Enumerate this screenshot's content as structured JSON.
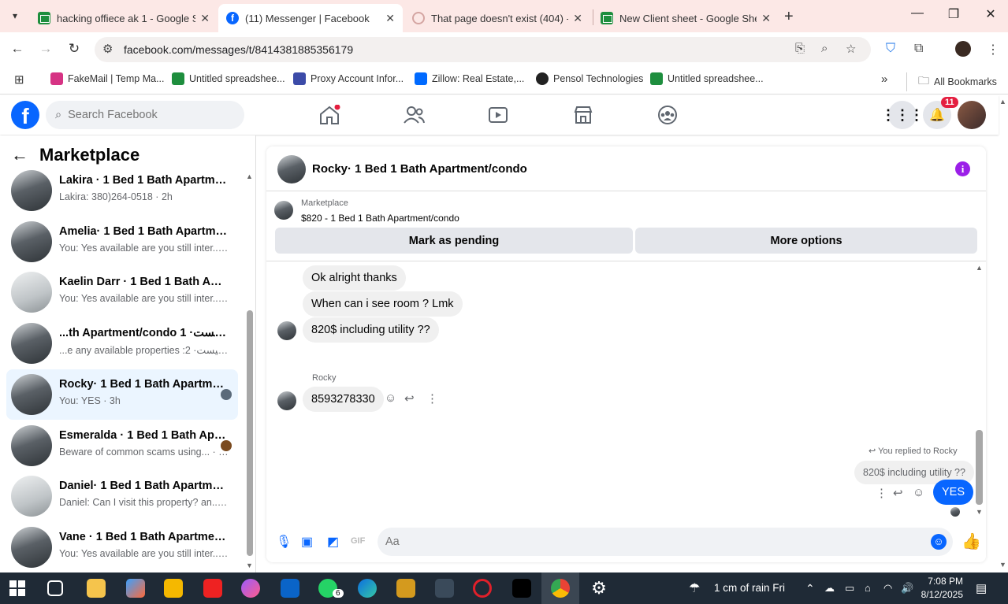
{
  "browser": {
    "tabs": [
      {
        "title": "hacking offiece ak 1 - Google S",
        "icon": "sheets"
      },
      {
        "title": "(11) Messenger | Facebook",
        "icon": "facebook",
        "active": true
      },
      {
        "title": "That page doesn't exist (404) - I",
        "icon": "error"
      },
      {
        "title": "New Client sheet - Google Shee",
        "icon": "sheets"
      }
    ],
    "url": "facebook.com/messages/t/8414381885356179",
    "bookmarks": [
      {
        "label": "FakeMail | Temp Ma...",
        "color": "#d63384"
      },
      {
        "label": "Untitled spreadshee...",
        "color": "#1e8e3e"
      },
      {
        "label": "Proxy Account Infor...",
        "color": "#3c4ba8"
      },
      {
        "label": "Zillow: Real Estate,...",
        "color": "#006aff"
      },
      {
        "label": "Pensol Technologies",
        "color": "#222222"
      },
      {
        "label": "Untitled spreadshee...",
        "color": "#1e8e3e"
      }
    ],
    "all_bookmarks": "All Bookmarks"
  },
  "facebook": {
    "search_placeholder": "Search Facebook",
    "notification_count": "11"
  },
  "sidebar": {
    "title": "Marketplace",
    "conversations": [
      {
        "name": "Lakira · 1 Bed 1 Bath Apartment/...",
        "snippet": "Lakira: 380)264-0518 · 2h",
        "thumb": "dark"
      },
      {
        "name": "Amelia· 1 Bed 1 Bath Apartment...",
        "snippet": "You: Yes available are you still inter... · 2h",
        "thumb": "dark"
      },
      {
        "name": "Kaelin Darr · 1 Bed 1 Bath Apart...",
        "snippet": "You: Yes available are you still inter... · 2h",
        "thumb": "light"
      },
      {
        "name": "...th Apartment/condo 1 ·سيليست",
        "snippet": "...e any available properties :سيليست· 2h",
        "thumb": "dark"
      },
      {
        "name": "Rocky· 1 Bed 1 Bath Apartmen...",
        "snippet": "You: YES · 3h",
        "thumb": "dark",
        "active": true
      },
      {
        "name": "Esmeralda · 1 Bed 1 Bath Apar...",
        "snippet": "Beware of common scams using... · 3h",
        "thumb": "dark"
      },
      {
        "name": "Daniel· 1 Bed 1 Bath Apartment/...",
        "snippet": "Daniel: Can I visit this property? an... · 3h",
        "thumb": "light"
      },
      {
        "name": "Vane · 1 Bed 1 Bath Apartment/c...",
        "snippet": "You: Yes available are you still inter... · 4h",
        "thumb": "dark"
      }
    ]
  },
  "chat": {
    "title": "Rocky· 1 Bed 1 Bath Apartment/condo",
    "marketplace_label": "Marketplace",
    "listing": "$820 - 1 Bed 1 Bath Apartment/condo",
    "mark_pending": "Mark as pending",
    "more_options": "More options",
    "messages": [
      {
        "text": "Ok alright thanks",
        "from": "them"
      },
      {
        "text": "When can i see room ? Lmk",
        "from": "them"
      },
      {
        "text": "820$ including utility ??",
        "from": "them"
      },
      {
        "sender": "Rocky",
        "text": "8593278330",
        "from": "them"
      }
    ],
    "reply_note": "You replied to Rocky",
    "quoted": "820$ including utility ??",
    "my_reply": "YES",
    "composer_placeholder": "Aa"
  },
  "taskbar": {
    "weather": "1 cm of rain Fri",
    "time": "7:08 PM",
    "date": "8/12/2025",
    "whatsapp_badge": "6"
  }
}
